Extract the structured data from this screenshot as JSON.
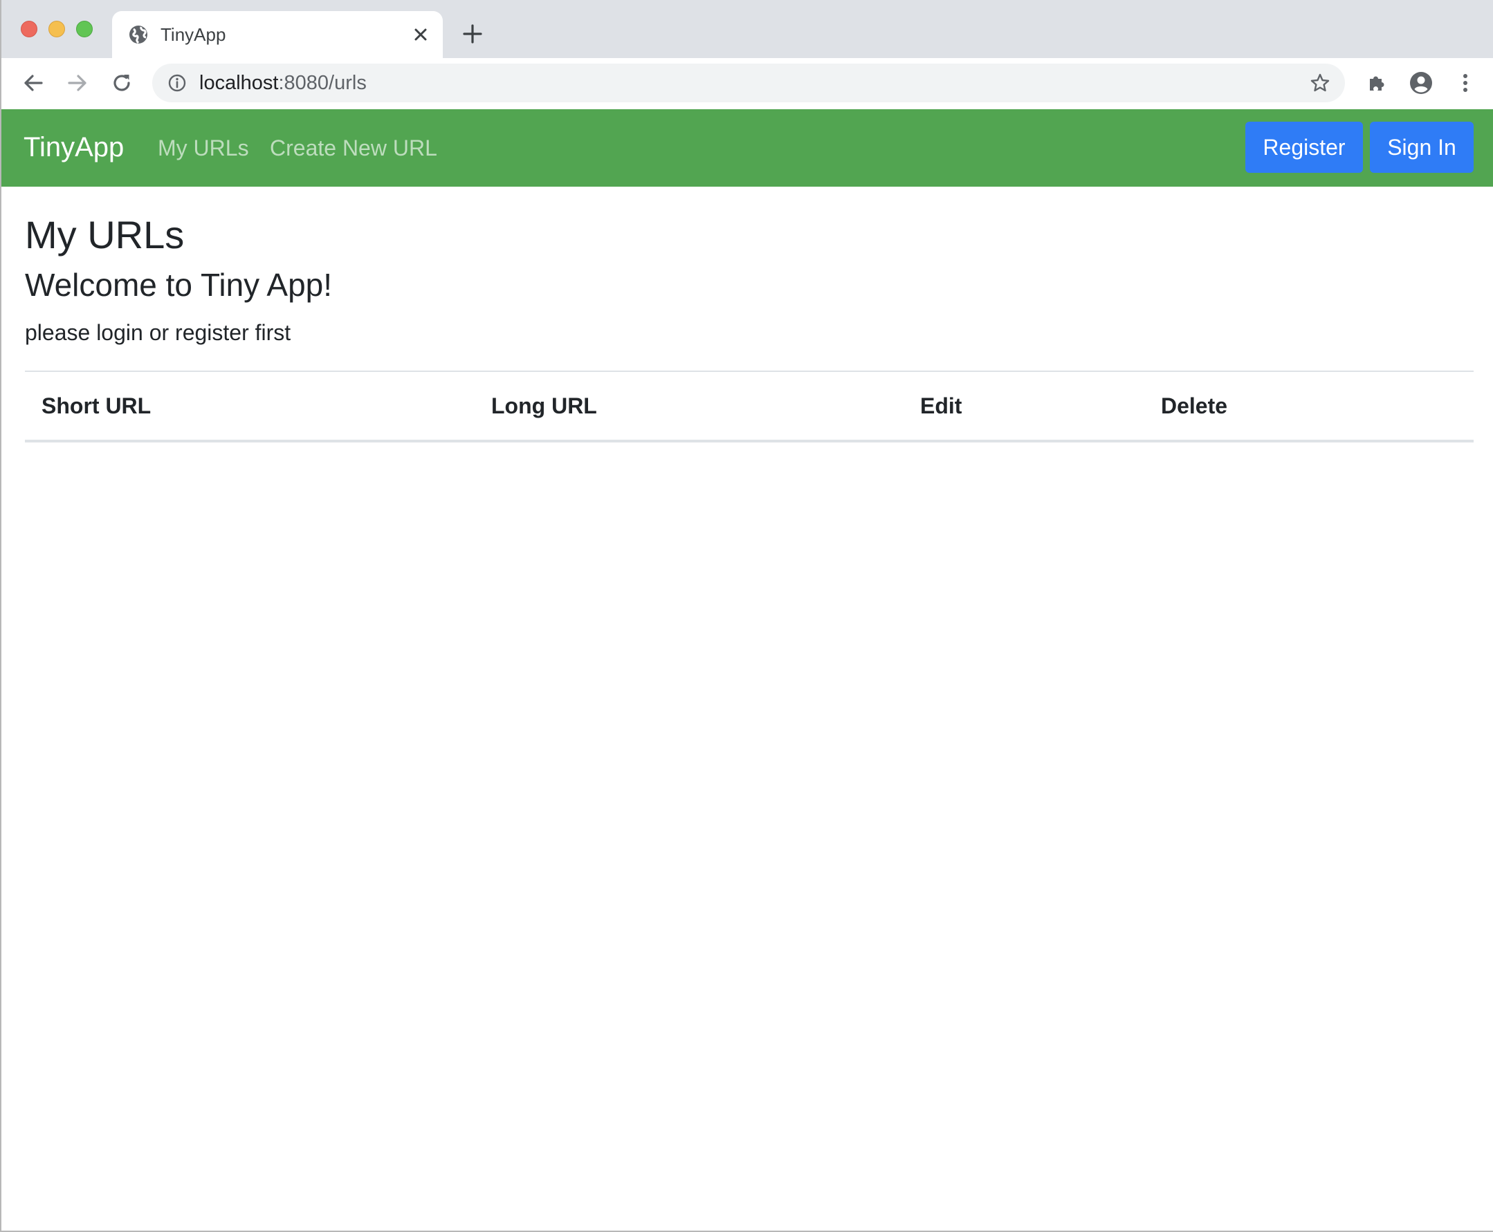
{
  "browser": {
    "tab_title": "TinyApp",
    "url_host": "localhost",
    "url_path": ":8080/urls"
  },
  "navbar": {
    "brand": "TinyApp",
    "links": [
      "My URLs",
      "Create New URL"
    ],
    "register_label": "Register",
    "signin_label": "Sign In",
    "color": "#52a551",
    "button_color": "#2f7cf6"
  },
  "main": {
    "heading": "My URLs",
    "welcome": "Welcome to Tiny App!",
    "hint": "please login or register first",
    "table": {
      "columns": [
        "Short URL",
        "Long URL",
        "Edit",
        "Delete"
      ],
      "rows": []
    }
  },
  "icons": {
    "favicon": "globe-icon",
    "tab_close": "close-icon",
    "new_tab": "plus-icon",
    "back": "arrow-left-icon",
    "forward": "arrow-right-icon",
    "reload": "reload-icon",
    "site_info": "info-icon",
    "bookmark": "star-icon",
    "extensions": "puzzle-icon",
    "profile": "account-icon",
    "menu": "kebab-menu-icon"
  }
}
